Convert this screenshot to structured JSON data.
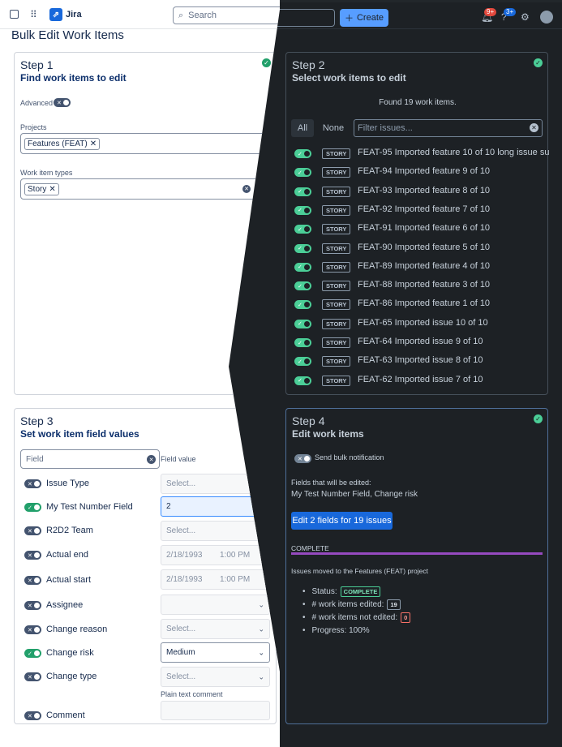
{
  "header": {
    "app_name": "Jira",
    "search_placeholder": "Search",
    "create_label": "Create",
    "notifications_badge": "9+",
    "help_badge": "3+"
  },
  "page_title": "Bulk Edit Work Items",
  "step1": {
    "title": "Step 1",
    "subtitle": "Find work items to edit",
    "advanced_label": "Advanced",
    "projects_label": "Projects",
    "project_chip": "Features (FEAT)",
    "types_label": "Work item types",
    "type_chip": "Story"
  },
  "step2": {
    "title": "Step 2",
    "subtitle": "Select work items to edit",
    "found_text": "Found 19 work items.",
    "all_label": "All",
    "none_label": "None",
    "filter_placeholder": "Filter issues...",
    "type_badge": "STORY",
    "issues": [
      "FEAT-95 Imported feature 10 of 10 long issue su",
      "FEAT-94 Imported feature 9 of 10",
      "FEAT-93 Imported feature 8 of 10",
      "FEAT-92 Imported feature 7 of 10",
      "FEAT-91 Imported feature 6 of 10",
      "FEAT-90 Imported feature 5 of 10",
      "FEAT-89 Imported feature 4 of 10",
      "FEAT-88 Imported feature 3 of 10",
      "FEAT-86 Imported feature 1 of 10",
      "FEAT-65 Imported issue 10 of 10",
      "FEAT-64 Imported issue 9 of 10",
      "FEAT-63 Imported issue 8 of 10",
      "FEAT-62 Imported issue 7 of 10"
    ]
  },
  "step3": {
    "title": "Step 3",
    "subtitle": "Set work item field values",
    "field_placeholder": "Field",
    "field_value_header": "Field value",
    "select_placeholder": "Select...",
    "plain_text_label": "Plain text comment",
    "fields": {
      "issue_type": {
        "label": "Issue Type"
      },
      "test_number": {
        "label": "My Test Number Field",
        "value": "2"
      },
      "r2d2": {
        "label": "R2D2 Team"
      },
      "actual_end": {
        "label": "Actual end",
        "date": "2/18/1993",
        "time": "1:00 PM"
      },
      "actual_start": {
        "label": "Actual start",
        "date": "2/18/1993",
        "time": "1:00 PM"
      },
      "assignee": {
        "label": "Assignee"
      },
      "change_reason": {
        "label": "Change reason"
      },
      "change_risk": {
        "label": "Change risk",
        "value": "Medium"
      },
      "change_type": {
        "label": "Change type"
      },
      "comment": {
        "label": "Comment"
      }
    }
  },
  "step4": {
    "title": "Step 4",
    "subtitle": "Edit work items",
    "notify_label": "Send bulk notification",
    "fields_edited_label": "Fields that will be edited:",
    "fields_edited_value": "My Test Number Field, Change risk",
    "edit_button": "Edit 2 fields for 19 issues",
    "complete_label": "COMPLETE",
    "progress_percent": 100,
    "moved_text": "Issues moved to the Features (FEAT) project",
    "status_label": "Status:",
    "status_value": "COMPLETE",
    "edited_label": "# work items edited:",
    "edited_value": "19",
    "not_edited_label": "# work items not edited:",
    "not_edited_value": "0",
    "progress_text": "Progress: 100%"
  },
  "colors": {
    "brand": "#1868db",
    "success": "#22a06b",
    "progress": "#964ac0",
    "dark_bg": "#1d2125"
  }
}
